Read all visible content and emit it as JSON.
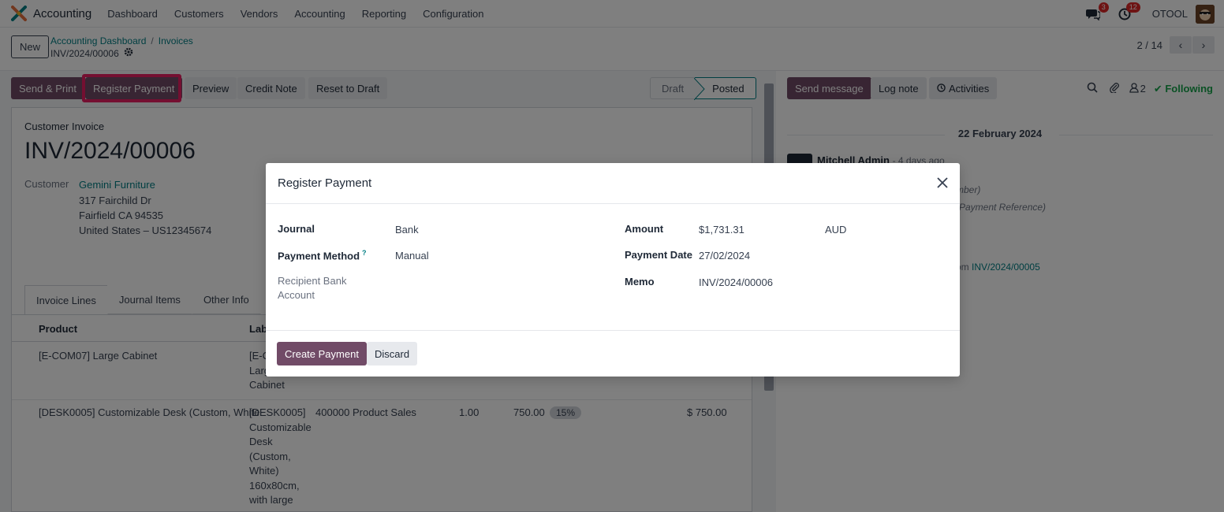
{
  "navbar": {
    "app_name": "Accounting",
    "menu": [
      "Dashboard",
      "Customers",
      "Vendors",
      "Accounting",
      "Reporting",
      "Configuration"
    ],
    "messages_badge": "3",
    "activities_badge": "12",
    "company": "OTOOL"
  },
  "control": {
    "new_label": "New",
    "breadcrumb": [
      "Accounting Dashboard",
      "Invoices"
    ],
    "record_name": "INV/2024/00006",
    "pager": "2 / 14"
  },
  "actions": {
    "send_print": "Send & Print",
    "register_payment": "Register Payment",
    "preview": "Preview",
    "credit_note": "Credit Note",
    "reset_draft": "Reset to Draft"
  },
  "status": {
    "steps": [
      "Draft",
      "Posted"
    ],
    "active": "Posted"
  },
  "invoice": {
    "doc_type": "Customer Invoice",
    "number": "INV/2024/00006",
    "customer_label": "Customer",
    "customer_name": "Gemini Furniture",
    "address": [
      "317 Fairchild Dr",
      "Fairfield CA 94535",
      "United States – US12345674"
    ]
  },
  "tabs": [
    "Invoice Lines",
    "Journal Items",
    "Other Info"
  ],
  "table": {
    "headers": {
      "product": "Product",
      "label": "Lab"
    },
    "rows": [
      {
        "product": "[E-COM07] Large Cabinet",
        "label_lines": [
          "[E-C",
          "Larg",
          "Cabinet"
        ]
      },
      {
        "product": "[DESK0005] Customizable Desk (Custom, White",
        "label_lines": [
          "[DESK0005]",
          "Customizable",
          "Desk",
          "(Custom,",
          "White)",
          "160x80cm,",
          "with large"
        ],
        "account": "400000 Product Sales",
        "quantity": "1.00",
        "price": "750.00",
        "tax": "15%",
        "subtotal": "$ 750.00"
      }
    ]
  },
  "chatter": {
    "send_message": "Send message",
    "log_note": "Log note",
    "activities": "Activities",
    "followers": "2",
    "following": "Following",
    "date": "22 February 2024",
    "author": "Mitchell Admin",
    "time": "- 4 days ago",
    "line1": "mber)",
    "line2": "(Payment Reference)",
    "line3_prefix": "om",
    "line3_link": "INV/2024/00005"
  },
  "modal": {
    "title": "Register Payment",
    "journal_label": "Journal",
    "journal_value": "Bank",
    "method_label": "Payment Method",
    "method_value": "Manual",
    "qmark": "?",
    "recipient_label_1": "Recipient Bank",
    "recipient_label_2": "Account",
    "amount_label": "Amount",
    "amount_value": "$1,731.31",
    "currency": "AUD",
    "date_label": "Payment Date",
    "date_value": "27/02/2024",
    "memo_label": "Memo",
    "memo_value": "INV/2024/00006",
    "create_label": "Create Payment",
    "discard_label": "Discard"
  },
  "colors": {
    "primary": "#714b67",
    "link": "#017e84",
    "highlight": "#e91e63",
    "badge": "#dc2626",
    "following": "#16a34a"
  }
}
